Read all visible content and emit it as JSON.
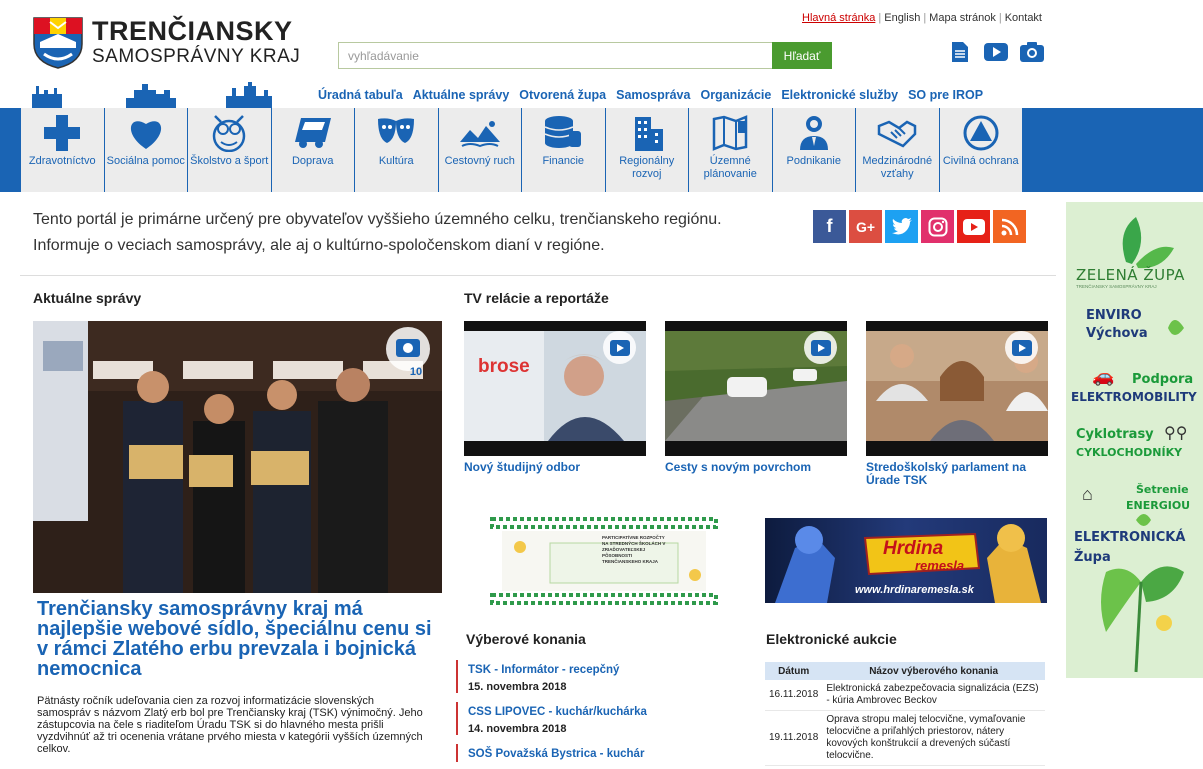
{
  "header": {
    "logo_line1": "TRENČIANSKY",
    "logo_line2": "SAMOSPRÁVNY KRAJ",
    "top_links": [
      "Hlavná stránka",
      "English",
      "Mapa stránok",
      "Kontakt"
    ],
    "search_placeholder": "vyhľadávanie",
    "search_button": "Hľadať",
    "icons": [
      "document-icon",
      "youtube-icon",
      "camera-icon"
    ]
  },
  "main_nav": [
    "Úradná tabuľa",
    "Aktuálne správy",
    "Otvorená župa",
    "Samospráva",
    "Organizácie",
    "Elektronické služby",
    "SO pre IROP"
  ],
  "categories": [
    {
      "label": "Zdravotníctvo",
      "icon": "health-cross-icon"
    },
    {
      "label": "Sociálna pomoc",
      "icon": "heart-icon"
    },
    {
      "label": "Školstvo a šport",
      "icon": "owl-icon"
    },
    {
      "label": "Doprava",
      "icon": "bus-icon"
    },
    {
      "label": "Kultúra",
      "icon": "theatre-masks-icon"
    },
    {
      "label": "Cestovný ruch",
      "icon": "landscape-icon"
    },
    {
      "label": "Financie",
      "icon": "coins-icon"
    },
    {
      "label": "Regionálny rozvoj",
      "icon": "buildings-icon"
    },
    {
      "label": "Územné plánovanie",
      "icon": "map-icon"
    },
    {
      "label": "Podnikanie",
      "icon": "businessman-icon"
    },
    {
      "label": "Medzinárodné vzťahy",
      "icon": "handshake-icon"
    },
    {
      "label": "Civilná ochrana",
      "icon": "civil-protection-icon"
    }
  ],
  "intro": "Tento portál je primárne určený pre obyvateľov vyššieho územného celku, trenčianskeho regiónu. Informuje o veciach samosprávy, ale aj o kultúrno-spoločenskom dianí v regióne.",
  "social": [
    {
      "name": "facebook-icon",
      "glyph": "f",
      "color": "#3b5998"
    },
    {
      "name": "google-plus-icon",
      "glyph": "G+",
      "color": "#dc4e41"
    },
    {
      "name": "twitter-icon",
      "glyph": "t",
      "color": "#1da1f2"
    },
    {
      "name": "instagram-icon",
      "glyph": "◎",
      "color": "#e1306c"
    },
    {
      "name": "youtube-icon",
      "glyph": "▶",
      "color": "#e62117"
    },
    {
      "name": "rss-icon",
      "glyph": "≋",
      "color": "#f26522"
    }
  ],
  "news": {
    "heading": "Aktuálne správy",
    "photo_count": "10",
    "title": "Trenčiansky samosprávny kraj má najlepšie webové sídlo, špeciálnu cenu si v rámci Zlatého erbu prevzala i bojnická nemocnica",
    "text": "Pätnásty ročník udeľovania cien za rozvoj informatizácie slovenských samospráv s názvom Zlatý erb bol pre Trenčiansky kraj (TSK) výnimočný. Jeho zástupcovia na čele s riaditeľom Úradu TSK si do hlavného mesta prišli vyzdvihnúť až tri ocenenia vrátane prvého miesta v kategórii vyšších územných celkov."
  },
  "tv": {
    "heading": "TV relácie a reportáže",
    "items": [
      "Nový študijný odbor",
      "Cesty s novým povrchom",
      "Stredoškolský parlament na Úrade TSK"
    ],
    "thumb1_sign": "brose"
  },
  "banners": {
    "banner1_text": "PARTICIPATÍVNE ROZPOČTY NA STREDNÝCH ŠKOLÁCH V ZRIAĎOVATEĽSKEJ PÔSOBNOSTI TRENČIANSKEHO KRAJA",
    "banner2_title1": "Hrdina",
    "banner2_title2": "remesla",
    "banner2_url": "www.hrdinaremesla.sk"
  },
  "vyberove": {
    "heading": "Výberové konania",
    "items": [
      {
        "title": "TSK - Informátor - recepčný",
        "date": "15. novembra 2018"
      },
      {
        "title": "CSS LIPOVEC - kuchár/kuchárka",
        "date": "14. novembra 2018"
      },
      {
        "title": "SOŠ Považská Bystrica - kuchár",
        "date": ""
      }
    ]
  },
  "aukcie": {
    "heading": "Elektronické aukcie",
    "col_date": "Dátum",
    "col_name": "Názov výberového konania",
    "rows": [
      {
        "date": "16.11.2018",
        "name": "Elektronická zabezpečovacia signalizácia (EZS) - kúria Ambrovec Beckov"
      },
      {
        "date": "19.11.2018",
        "name": "Oprava stropu malej telocvične, vymaľovanie telocvične a priľahlých priestorov, nátery kovových konštrukcií a drevených súčastí telocvične."
      }
    ]
  },
  "zelena": {
    "title": "ZELENÁ ŽUPA",
    "subtitle": "TRENČIANSKY SAMOSPRÁVNY KRAJ",
    "items": [
      "ENVIRO",
      "Výchova",
      "Podpora",
      "ELEKTROMOBILITY",
      "Cyklotrasy",
      "CYKLOCHODNÍKY",
      "Šetrenie",
      "ENERGIOU",
      "ELEKTRONICKÁ",
      "Župa"
    ]
  },
  "colors": {
    "brand_blue": "#1a64b4",
    "search_green": "#4a9b2f",
    "accent_red": "#cc3333"
  }
}
